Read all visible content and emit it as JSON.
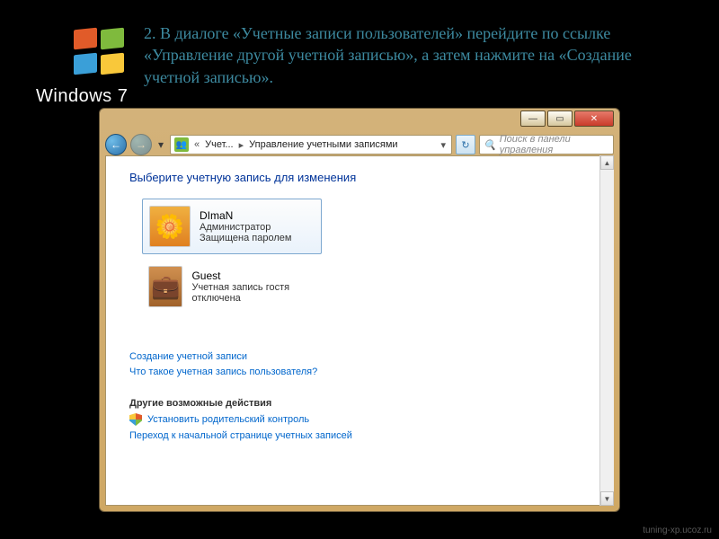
{
  "instruction": "2. В диалоге «Учетные записи пользователей» перейдите по ссылке «Управление другой учетной записью», а затем нажмите на «Создание учетной записью».",
  "logo_text": "Windows 7",
  "titlebar": {
    "min": "—",
    "max": "▭",
    "close": "✕"
  },
  "addressbar": {
    "crumb1": "Учет...",
    "crumb2": "Управление учетными записями",
    "refresh": "↻",
    "dropdown": "▾"
  },
  "search": {
    "placeholder": "Поиск в панели управления",
    "icon": "🔍"
  },
  "content": {
    "heading": "Выберите учетную запись для изменения",
    "accounts": [
      {
        "name": "DImaN",
        "role": "Администратор",
        "status": "Защищена паролем"
      },
      {
        "name": "Guest",
        "role": "",
        "status": "Учетная запись гостя отключена"
      }
    ],
    "links": {
      "create": "Создание учетной записи",
      "what": "Что такое учетная запись пользователя?"
    },
    "other_heading": "Другие возможные действия",
    "other": {
      "parental": "Установить родительский контроль",
      "home": "Переход к начальной странице учетных записей"
    }
  },
  "watermark": "tuning-xp.ucoz.ru"
}
